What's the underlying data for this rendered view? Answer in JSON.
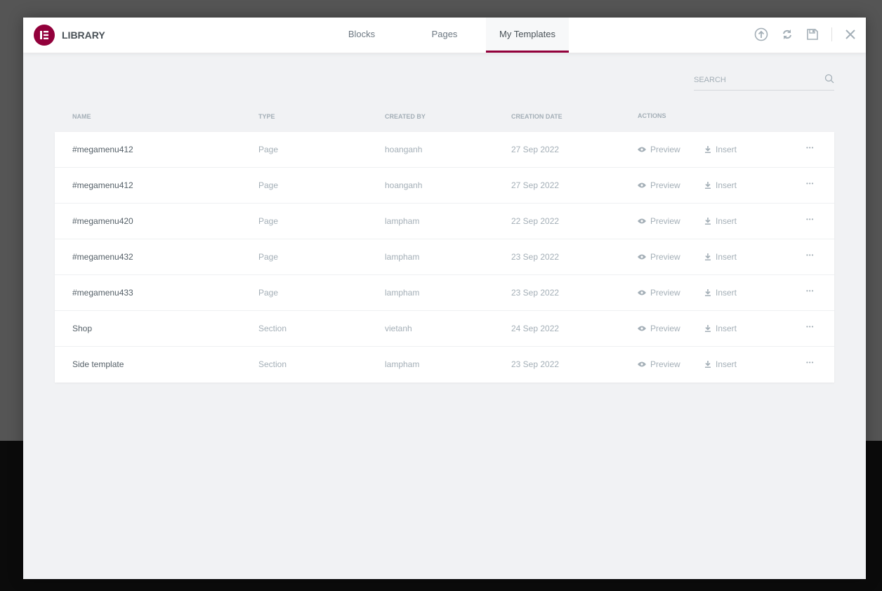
{
  "header": {
    "title": "LIBRARY",
    "tabs": [
      "Blocks",
      "Pages",
      "My Templates"
    ],
    "active_tab": "My Templates",
    "brand_color": "#92003b"
  },
  "search": {
    "placeholder": "SEARCH"
  },
  "table": {
    "headers": [
      "NAME",
      "TYPE",
      "CREATED BY",
      "CREATION DATE",
      "ACTIONS"
    ],
    "preview_label": "Preview",
    "insert_label": "Insert",
    "rows": [
      {
        "name": "#megamenu412",
        "type": "Page",
        "author": "hoanganh",
        "date": "27 Sep 2022"
      },
      {
        "name": "#megamenu412",
        "type": "Page",
        "author": "hoanganh",
        "date": "27 Sep 2022"
      },
      {
        "name": "#megamenu420",
        "type": "Page",
        "author": "lampham",
        "date": "22 Sep 2022"
      },
      {
        "name": "#megamenu432",
        "type": "Page",
        "author": "lampham",
        "date": "23 Sep 2022"
      },
      {
        "name": "#megamenu433",
        "type": "Page",
        "author": "lampham",
        "date": "23 Sep 2022"
      },
      {
        "name": "Shop",
        "type": "Section",
        "author": "vietanh",
        "date": "24 Sep 2022"
      },
      {
        "name": "Side template",
        "type": "Section",
        "author": "lampham",
        "date": "23 Sep 2022"
      }
    ]
  }
}
